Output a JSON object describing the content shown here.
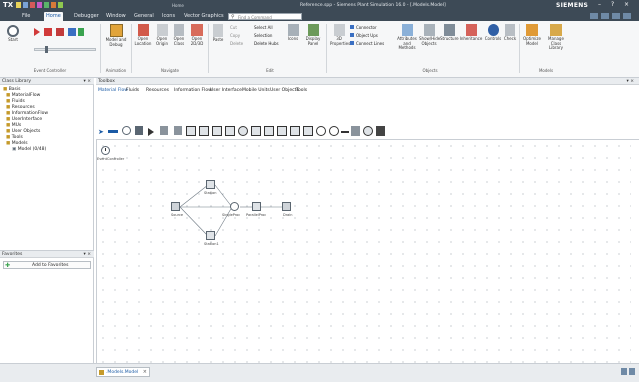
{
  "app": {
    "logo": "TX",
    "title": "Reference.spp - Siemens Plant Simulation 16.0 - [.Models.Model]",
    "center_tab_title": "Home",
    "brand": "SIEMENS",
    "window_controls": [
      "–",
      "?",
      "×"
    ]
  },
  "ribbon_tabs": [
    "File",
    "Home",
    "Debugger",
    "Window",
    "General",
    "Icons",
    "Vector Graphics"
  ],
  "active_tab": "Home",
  "search": {
    "placeholder": "Find a Command"
  },
  "ribbon_groups": [
    {
      "label": "Event Controller",
      "buttons": [
        "Start",
        "Reset",
        "Step",
        "Stop"
      ]
    },
    {
      "label": "Animation",
      "buttons": [
        "Model and Debug"
      ]
    },
    {
      "label": "Navigate",
      "buttons": [
        "Open Location",
        "Open Origin",
        "Open Class",
        "Open 2D/3D"
      ]
    },
    {
      "label": "Edit",
      "buttons": [
        "Paste",
        "Cut",
        "Copy",
        "Delete",
        "Select All",
        "Selection",
        "Delete Hubs",
        "Icons",
        "Display Panel"
      ]
    },
    {
      "label": "Objects",
      "buttons": [
        "3D Properties",
        "Connector",
        "Object Ups",
        "Connect Lines",
        "Attributes and Methods",
        "Show/Hide Objects",
        "Structure",
        "Inheritance",
        "Controls",
        "Check"
      ]
    },
    {
      "label": "Models",
      "buttons": [
        "Optimize Model",
        "Manage Class Library"
      ]
    }
  ],
  "class_library": {
    "title": "Class Library",
    "items": [
      {
        "label": "Basis",
        "level": 0
      },
      {
        "label": "MaterialFlow",
        "level": 1
      },
      {
        "label": "Fluids",
        "level": 1
      },
      {
        "label": "Resources",
        "level": 1
      },
      {
        "label": "InformationFlow",
        "level": 1
      },
      {
        "label": "UserInterface",
        "level": 1
      },
      {
        "label": "MUs",
        "level": 1
      },
      {
        "label": "User Objects",
        "level": 1
      },
      {
        "label": "Tools",
        "level": 1
      },
      {
        "label": "Models",
        "level": 1
      },
      {
        "label": "Model (0/48)",
        "level": 2
      }
    ]
  },
  "favorites": {
    "title": "Favorites",
    "add_label": "Add to Favorites"
  },
  "toolbox": {
    "title": "Toolbox",
    "tabs": [
      "Material Flow",
      "Fluids",
      "Resources",
      "Information Flow",
      "User Interface",
      "Mobile Units",
      "User Objects",
      "Tools"
    ],
    "icons": [
      "pointer",
      "connector",
      "event-controller",
      "source",
      "drain",
      "single-proc",
      "parallel-proc",
      "assembly",
      "disassembly",
      "buffer",
      "sorter",
      "cycle",
      "line",
      "track",
      "turntable",
      "turnplate",
      "conveyor",
      "station",
      "transfer",
      "hub",
      "place"
    ]
  },
  "model": {
    "event_controller_label": "EventController",
    "nodes": [
      {
        "name": "Source",
        "label": "Source"
      },
      {
        "name": "Station",
        "label": "Station"
      },
      {
        "name": "Station1",
        "label": "Station1"
      },
      {
        "name": "SingleProc",
        "label": "SingleProc"
      },
      {
        "name": "ParallelProc",
        "label": "ParallelProc"
      },
      {
        "name": "Drain",
        "label": "Drain"
      }
    ]
  },
  "bottom_tab": {
    "label": ".Models.Model"
  },
  "colors": {
    "titlebar": "#3d4a56",
    "accent": "#1a5aa5",
    "ribbon": "#f6f7f8"
  }
}
